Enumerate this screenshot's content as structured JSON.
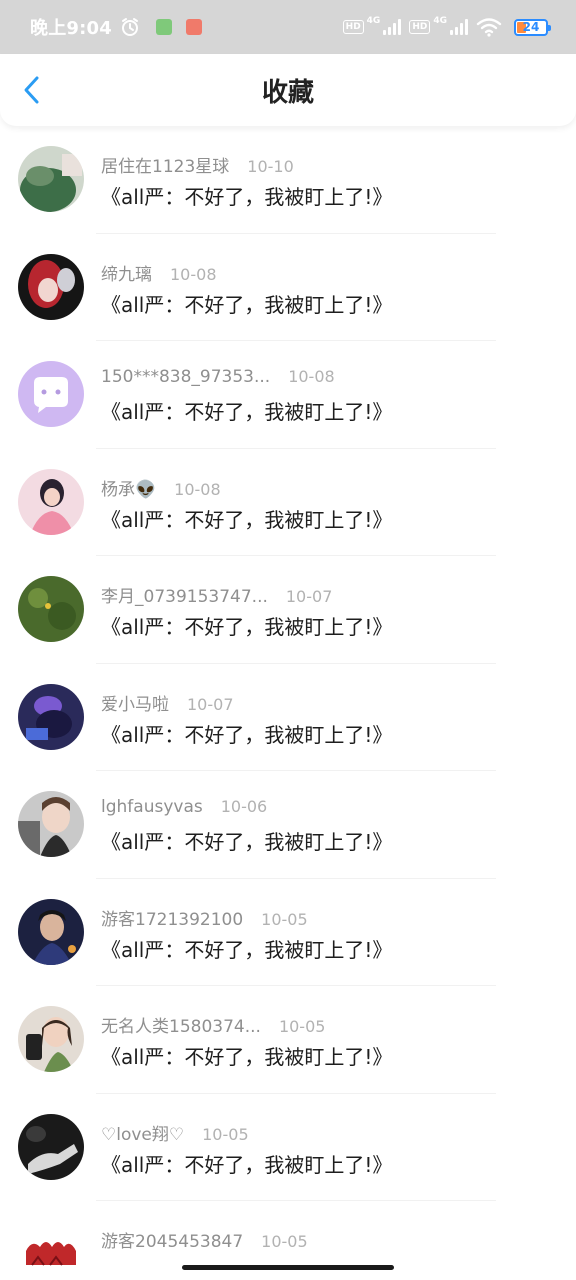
{
  "status_bar": {
    "time": "晚上9:04",
    "hd1": "HD",
    "net1": "4G",
    "hd2": "HD",
    "net2": "4G",
    "battery": "24"
  },
  "nav": {
    "title": "收藏"
  },
  "favorites": [
    {
      "name": "居住在1123星球",
      "date": "10-10",
      "title": "《all严：不好了，我被盯上了!》"
    },
    {
      "name": "缔九璃",
      "date": "10-08",
      "title": "《all严：不好了，我被盯上了!》"
    },
    {
      "name": "150***838_97353...",
      "date": "10-08",
      "title": "《all严：不好了，我被盯上了!》"
    },
    {
      "name": "杨承👽",
      "date": "10-08",
      "title": "《all严：不好了，我被盯上了!》"
    },
    {
      "name": "李月_0739153747...",
      "date": "10-07",
      "title": "《all严：不好了，我被盯上了!》"
    },
    {
      "name": "爱小马啦",
      "date": "10-07",
      "title": "《all严：不好了，我被盯上了!》"
    },
    {
      "name": "lghfausyvas",
      "date": "10-06",
      "title": "《all严：不好了，我被盯上了!》"
    },
    {
      "name": "游客1721392100",
      "date": "10-05",
      "title": "《all严：不好了，我被盯上了!》"
    },
    {
      "name": "无名人类1580374...",
      "date": "10-05",
      "title": "《all严：不好了，我被盯上了!》"
    },
    {
      "name": "♡love翔♡",
      "date": "10-05",
      "title": "《all严：不好了，我被盯上了!》"
    },
    {
      "name": "游客2045453847",
      "date": "10-05",
      "title": ""
    }
  ]
}
